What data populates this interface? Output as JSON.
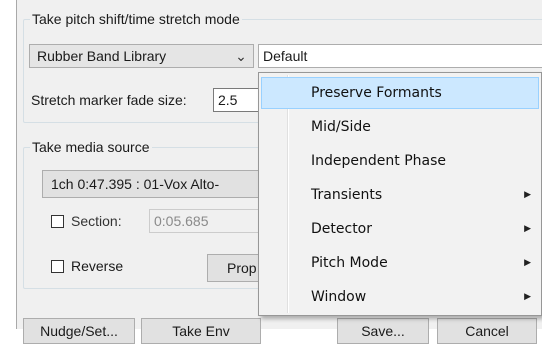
{
  "pitch_group": {
    "legend": "Take pitch shift/time stretch mode",
    "library_select": "Rubber Band Library",
    "preset_select": "Default",
    "fade_label": "Stretch marker fade size:",
    "fade_value": "2.5"
  },
  "source_group": {
    "legend": "Take media source",
    "source_value": "1ch 0:47.395 : 01-Vox Alto-",
    "section_label": "Section:",
    "section_value": "0:05.685",
    "reverse_label": "Reverse",
    "properties_button": "Prop"
  },
  "bottom_buttons": [
    "Nudge/Set...",
    "Take Env",
    "Save...",
    "Cancel"
  ],
  "menu": {
    "items": [
      {
        "label": "Preserve Formants",
        "submenu": false,
        "highlighted": true
      },
      {
        "label": "Mid/Side",
        "submenu": false,
        "highlighted": false
      },
      {
        "label": "Independent Phase",
        "submenu": false,
        "highlighted": false
      },
      {
        "label": "Transients",
        "submenu": true,
        "highlighted": false
      },
      {
        "label": "Detector",
        "submenu": true,
        "highlighted": false
      },
      {
        "label": "Pitch Mode",
        "submenu": true,
        "highlighted": false
      },
      {
        "label": "Window",
        "submenu": true,
        "highlighted": false
      }
    ]
  },
  "icons": {
    "dropdown_arrow": "⌄",
    "submenu_arrow": "▶"
  }
}
